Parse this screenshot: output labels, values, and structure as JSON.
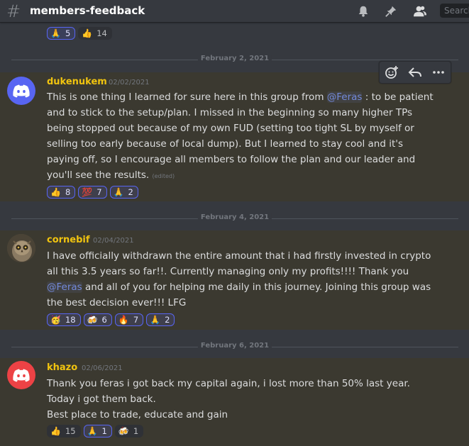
{
  "channel": {
    "name": "members-feedback",
    "search_placeholder": "Search"
  },
  "previous_reactions": [
    {
      "emoji": "🙏",
      "count": "5",
      "active": true
    },
    {
      "emoji": "👍",
      "count": "14",
      "active": false
    }
  ],
  "dividers": [
    "February 2, 2021",
    "February 4, 2021",
    "February 6, 2021"
  ],
  "messages": [
    {
      "username": "dukenukem",
      "timestamp": "02/02/2021",
      "text_before": "This is one thing I learned for sure here in this group from ",
      "mention": "@Feras",
      "text_after": " : to be patient and to stick to the setup/plan. I missed in the beginning so many higher TPs being stopped out because of my own FUD (setting too tight SL by myself or selling too early because of local dump). But I learned to stay cool and it's paying off, so I encourage all members to follow the plan and our leader and you'll see the results.",
      "edited": "(edited)",
      "reactions": [
        {
          "emoji": "👍",
          "count": "8",
          "active": true
        },
        {
          "emoji": "💯",
          "count": "7",
          "active": true
        },
        {
          "emoji": "🙏",
          "count": "2",
          "active": true
        }
      ]
    },
    {
      "username": "cornebif",
      "timestamp": "02/04/2021",
      "text_before": "I have officially withdrawn the entire amount that i had firstly invested in crypto all this 3.5 years so far!!. Currently managing only my profits!!!! Thank you ",
      "mention": "@Feras",
      "text_after": " and all of you for helping me daily in this journey. Joining this group was the best decision ever!!! LFG",
      "reactions": [
        {
          "emoji": "🥳",
          "count": "18",
          "active": true
        },
        {
          "emoji": "🍻",
          "count": "6",
          "active": true
        },
        {
          "emoji": "🔥",
          "count": "7",
          "active": true
        },
        {
          "emoji": "🙏",
          "count": "2",
          "active": true
        }
      ]
    },
    {
      "username": "khazo",
      "timestamp": "02/06/2021",
      "line1": "Thank you feras i got back my capital again, i lost more than 50% last year.",
      "line2": "Today i got them back.",
      "line3": "Best place to trade, educate and gain",
      "reactions": [
        {
          "emoji": "👍",
          "count": "15",
          "active": false
        },
        {
          "emoji": "🙏",
          "count": "1",
          "active": true
        },
        {
          "emoji": "🍻",
          "count": "1",
          "active": false
        }
      ]
    }
  ],
  "colors": {
    "background": "#36393f",
    "username": "#f1c40f",
    "mention": "#7289da",
    "discord_blurple": "#5865f2",
    "discord_red": "#ed4245"
  }
}
